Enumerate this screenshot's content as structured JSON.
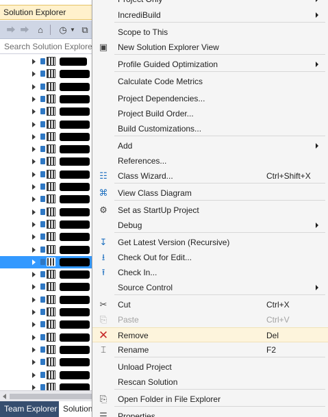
{
  "solution_explorer": {
    "title": "Solution Explorer",
    "search_placeholder": "Search Solution Explorer",
    "toolbar_icons": [
      "back-arrow-icon",
      "forward-arrow-icon",
      "home-icon",
      "history-icon",
      "dropdown-icon",
      "new-window-icon"
    ],
    "tree_rows": [
      {
        "redact_w": 40,
        "partial": ""
      },
      {
        "redact_w": 44,
        "partial": ""
      },
      {
        "redact_w": 44,
        "partial": ""
      },
      {
        "redact_w": 44,
        "partial": ""
      },
      {
        "redact_w": 44,
        "partial": ""
      },
      {
        "redact_w": 44,
        "partial": ""
      },
      {
        "redact_w": 44,
        "partial": ""
      },
      {
        "redact_w": 44,
        "partial": ""
      },
      {
        "redact_w": 44,
        "partial": ""
      },
      {
        "redact_w": 44,
        "partial": ""
      },
      {
        "redact_w": 44,
        "partial": ""
      },
      {
        "redact_w": 44,
        "partial": ""
      },
      {
        "redact_w": 44,
        "partial": ""
      },
      {
        "redact_w": 44,
        "partial": ""
      },
      {
        "redact_w": 44,
        "partial": ""
      },
      {
        "redact_w": 44,
        "partial": ""
      },
      {
        "redact_w": 44,
        "partial": ""
      },
      {
        "redact_w": 44,
        "partial": ""
      },
      {
        "redact_w": 44,
        "partial": ""
      },
      {
        "redact_w": 44,
        "partial": ""
      },
      {
        "redact_w": 44,
        "partial": ""
      },
      {
        "redact_w": 44,
        "partial": ""
      },
      {
        "redact_w": 44,
        "partial": ""
      },
      {
        "redact_w": 44,
        "partial": ""
      },
      {
        "redact_w": 44,
        "partial": ""
      },
      {
        "redact_w": 44,
        "partial": ""
      },
      {
        "redact_w": 44,
        "partial": ""
      },
      {
        "redact_w": 44,
        "partial": ""
      }
    ],
    "selected_row_index": 16,
    "tabs": {
      "team_explorer": "Team Explorer",
      "solution": "Solution"
    }
  },
  "context_menu": {
    "items": [
      {
        "label": "Project Only",
        "shortcut": "",
        "submenu": true,
        "icon": "",
        "disabled": false,
        "highlight": false
      },
      {
        "label": "IncrediBuild",
        "shortcut": "",
        "submenu": true,
        "icon": "",
        "disabled": false,
        "highlight": false
      },
      {
        "label": "Scope to This",
        "shortcut": "",
        "submenu": false,
        "icon": "",
        "disabled": false,
        "highlight": false
      },
      {
        "label": "New Solution Explorer View",
        "shortcut": "",
        "submenu": false,
        "icon": "new-view-icon",
        "disabled": false,
        "highlight": false
      },
      {
        "label": "Profile Guided Optimization",
        "shortcut": "",
        "submenu": true,
        "icon": "",
        "disabled": false,
        "highlight": false
      },
      {
        "label": "Calculate Code Metrics",
        "shortcut": "",
        "submenu": false,
        "icon": "",
        "disabled": false,
        "highlight": false
      },
      {
        "label": "Project Dependencies...",
        "shortcut": "",
        "submenu": false,
        "icon": "",
        "disabled": false,
        "highlight": false
      },
      {
        "label": "Project Build Order...",
        "shortcut": "",
        "submenu": false,
        "icon": "",
        "disabled": false,
        "highlight": false
      },
      {
        "label": "Build Customizations...",
        "shortcut": "",
        "submenu": false,
        "icon": "",
        "disabled": false,
        "highlight": false
      },
      {
        "label": "Add",
        "shortcut": "",
        "submenu": true,
        "icon": "",
        "disabled": false,
        "highlight": false
      },
      {
        "label": "References...",
        "shortcut": "",
        "submenu": false,
        "icon": "",
        "disabled": false,
        "highlight": false
      },
      {
        "label": "Class Wizard...",
        "shortcut": "Ctrl+Shift+X",
        "submenu": false,
        "icon": "class-wizard-icon",
        "disabled": false,
        "highlight": false
      },
      {
        "label": "View Class Diagram",
        "shortcut": "",
        "submenu": false,
        "icon": "class-diagram-icon",
        "disabled": false,
        "highlight": false
      },
      {
        "label": "Set as StartUp Project",
        "shortcut": "",
        "submenu": false,
        "icon": "gear-icon",
        "disabled": false,
        "highlight": false
      },
      {
        "label": "Debug",
        "shortcut": "",
        "submenu": true,
        "icon": "",
        "disabled": false,
        "highlight": false
      },
      {
        "label": "Get Latest Version (Recursive)",
        "shortcut": "",
        "submenu": false,
        "icon": "get-latest-icon",
        "disabled": false,
        "highlight": false
      },
      {
        "label": "Check Out for Edit...",
        "shortcut": "",
        "submenu": false,
        "icon": "check-out-icon",
        "disabled": false,
        "highlight": false
      },
      {
        "label": "Check In...",
        "shortcut": "",
        "submenu": false,
        "icon": "check-in-icon",
        "disabled": false,
        "highlight": false
      },
      {
        "label": "Source Control",
        "shortcut": "",
        "submenu": true,
        "icon": "",
        "disabled": false,
        "highlight": false
      },
      {
        "label": "Cut",
        "shortcut": "Ctrl+X",
        "submenu": false,
        "icon": "scissors-icon",
        "disabled": false,
        "highlight": false
      },
      {
        "label": "Paste",
        "shortcut": "Ctrl+V",
        "submenu": false,
        "icon": "paste-icon",
        "disabled": true,
        "highlight": false
      },
      {
        "label": "Remove",
        "shortcut": "Del",
        "submenu": false,
        "icon": "remove-x-icon",
        "disabled": false,
        "highlight": true
      },
      {
        "label": "Rename",
        "shortcut": "F2",
        "submenu": false,
        "icon": "rename-icon",
        "disabled": false,
        "highlight": false
      },
      {
        "label": "Unload Project",
        "shortcut": "",
        "submenu": false,
        "icon": "",
        "disabled": false,
        "highlight": false
      },
      {
        "label": "Rescan Solution",
        "shortcut": "",
        "submenu": false,
        "icon": "",
        "disabled": false,
        "highlight": false
      },
      {
        "label": "Open Folder in File Explorer",
        "shortcut": "",
        "submenu": false,
        "icon": "open-folder-icon",
        "disabled": false,
        "highlight": false
      },
      {
        "label": "Properties",
        "shortcut": "",
        "submenu": false,
        "icon": "properties-icon",
        "disabled": false,
        "highlight": false
      }
    ]
  }
}
